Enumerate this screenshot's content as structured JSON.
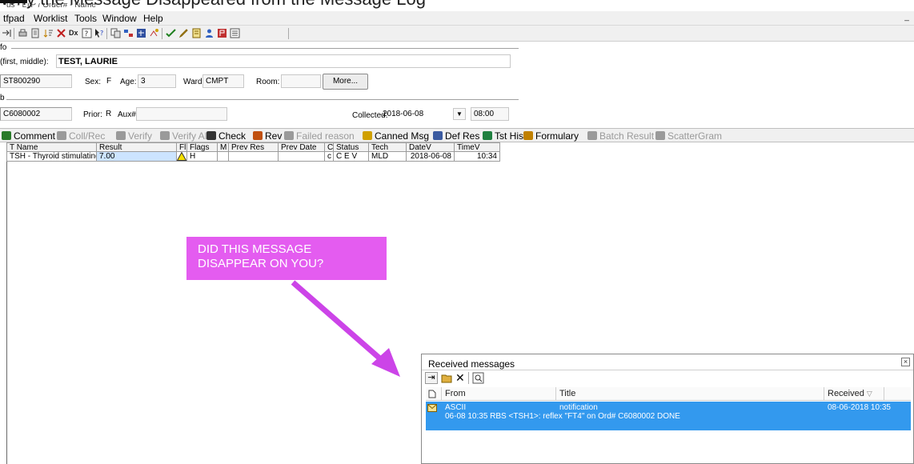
{
  "slide_caption": "Why the Message Disappeared from the Message Log",
  "window": {
    "title": "us - LTP / Order# - Name"
  },
  "menu": {
    "items": [
      "tfpad",
      "Worklist",
      "Tools",
      "Window",
      "Help"
    ]
  },
  "patient": {
    "name_label": "(first, middle):",
    "name_value": "TEST, LAURIE",
    "id_value": "ST800290",
    "sex_label": "Sex:",
    "sex_value": "F",
    "age_label": "Age:",
    "age_value": "3",
    "ward_label": "Ward:",
    "ward_value": "CMPT",
    "room_label": "Room:",
    "room_value": "",
    "more_button": "More...",
    "section_top": "fo",
    "section_order": "b"
  },
  "order": {
    "accession_value": "C6080002",
    "prior_label": "Prior:",
    "prior_value": "R",
    "aux_label": "Aux#:",
    "aux_value": "",
    "collected_label": "Collected:",
    "collected_date": "2018-06-08",
    "collected_time": "08:00"
  },
  "results_toolbar": {
    "items": [
      {
        "label": "Comment",
        "enabled": true,
        "icon": "comment-icon",
        "color": "#2a7a2a"
      },
      {
        "label": "Coll/Rec",
        "enabled": false,
        "icon": "coll-rec-icon",
        "color": "#9a9a9a"
      },
      {
        "label": "Verify",
        "enabled": false,
        "icon": "verify-icon",
        "color": "#9a9a9a"
      },
      {
        "label": "Verify All",
        "enabled": false,
        "icon": "verify-all-icon",
        "color": "#9a9a9a"
      },
      {
        "label": "Check",
        "enabled": true,
        "icon": "hand-icon",
        "color": "#333333"
      },
      {
        "label": "Rev",
        "enabled": true,
        "icon": "rev-icon",
        "color": "#c05010"
      },
      {
        "label": "Failed reason",
        "enabled": false,
        "icon": "failed-reason-icon",
        "color": "#9a9a9a"
      },
      {
        "label": "Canned Msg",
        "enabled": true,
        "icon": "canned-msg-icon",
        "color": "#d0a000"
      },
      {
        "label": "Def Res",
        "enabled": true,
        "icon": "def-res-icon",
        "color": "#3a5aa0"
      },
      {
        "label": "Tst Hist",
        "enabled": true,
        "icon": "tst-hist-icon",
        "color": "#208040"
      },
      {
        "label": "Formulary",
        "enabled": true,
        "icon": "formulary-icon",
        "color": "#c08000"
      },
      {
        "label": "Batch Result",
        "enabled": false,
        "icon": "batch-result-icon",
        "color": "#9a9a9a"
      },
      {
        "label": "ScatterGram",
        "enabled": false,
        "icon": "scattergram-icon",
        "color": "#9a9a9a"
      }
    ]
  },
  "results_grid": {
    "columns": [
      "T Name",
      "Result",
      "Fl",
      "Flags",
      "M",
      "Prev Res",
      "Prev Date",
      "C",
      "Status",
      "Tech",
      "DateV",
      "TimeV"
    ],
    "rows": [
      [
        "TSH - Thyroid stimulating",
        "7.00",
        "",
        "H",
        "",
        "",
        "",
        "c",
        "C E V",
        "MLD",
        "2018-06-08",
        "10:34"
      ]
    ]
  },
  "callout": {
    "line1": "DID THIS MESSAGE",
    "line2": "DISAPPEAR ON YOU?"
  },
  "colors": {
    "callout": "#e45cf0",
    "arrow": "#cc44e8",
    "selection": "#3399ee"
  },
  "messages_panel": {
    "title": "Received messages",
    "columns": [
      "From",
      "Title",
      "Received"
    ],
    "rows": [
      {
        "from": "ASCII",
        "title": "notification",
        "received": "08-06-2018 10:35",
        "detail": "06-08 10:35 RBS <TSH1>: reflex \"FT4\" on Ord# C6080002 DONE"
      }
    ]
  }
}
